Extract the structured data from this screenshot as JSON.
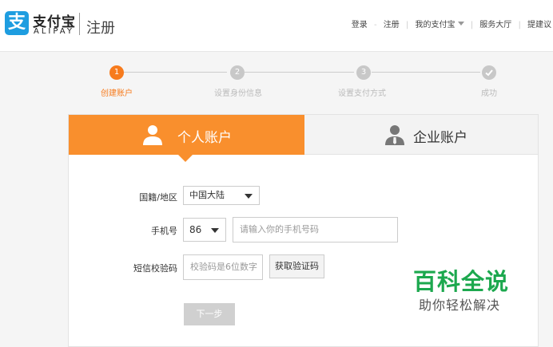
{
  "brand": {
    "icon_glyph": "支",
    "name_cn": "支付宝",
    "name_en": "ALIPAY",
    "page_name": "注册",
    "color": "#1e9de0"
  },
  "topnav": {
    "login": "登录",
    "separator": "-",
    "register": "注册",
    "my_alipay": "我的支付宝",
    "service_hall": "服务大厅",
    "suggest": "提建议"
  },
  "steps": [
    {
      "number": "1",
      "label": "创建账户",
      "state": "active"
    },
    {
      "number": "2",
      "label": "设置身份信息",
      "state": "pending"
    },
    {
      "number": "3",
      "label": "设置支付方式",
      "state": "pending"
    },
    {
      "icon": "check-icon",
      "label": "成功",
      "state": "pending"
    }
  ],
  "tabs": {
    "personal": "个人账户",
    "business": "企业账户",
    "accent": "#f98f2d"
  },
  "form": {
    "region_label": "国籍/地区",
    "region_value": "中国大陆",
    "phone_label": "手机号",
    "country_code": "86",
    "phone_placeholder": "请输入你的手机号码",
    "sms_label": "短信校验码",
    "sms_placeholder": "校验码是6位数字",
    "get_code": "获取验证码",
    "next": "下一步"
  },
  "watermark": {
    "title": "百科全说",
    "subtitle": "助你轻松解决"
  }
}
